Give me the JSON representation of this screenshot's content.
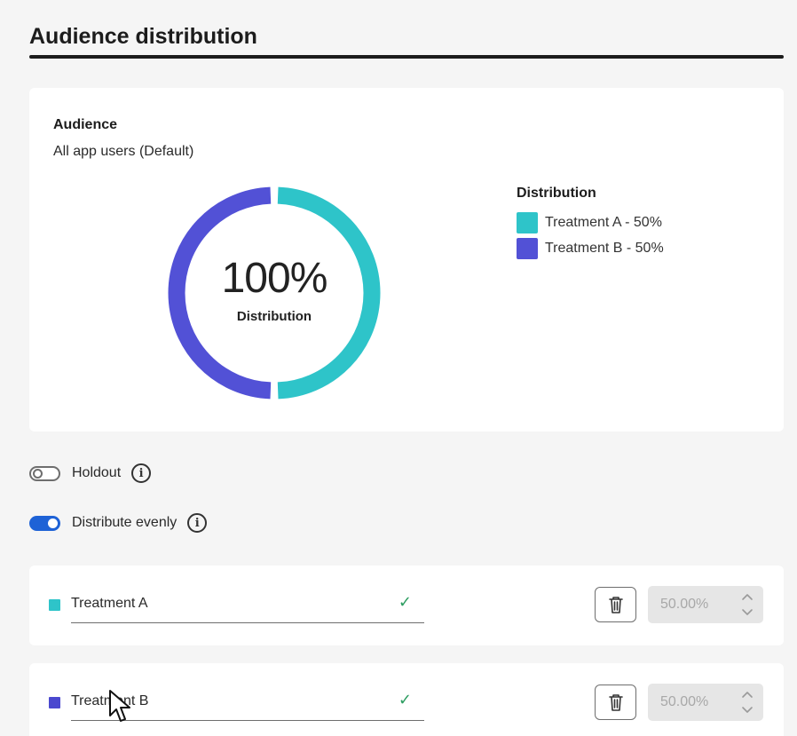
{
  "page": {
    "title": "Audience distribution"
  },
  "audience": {
    "label": "Audience",
    "value": "All app users (Default)"
  },
  "donut": {
    "center_value": "100%",
    "center_label": "Distribution",
    "segments": [
      {
        "name": "Treatment A",
        "fraction": 0.5,
        "color": "#2ec4c9"
      },
      {
        "name": "Treatment B",
        "fraction": 0.5,
        "color": "#5251d6"
      }
    ]
  },
  "legend": {
    "title": "Distribution",
    "items": [
      {
        "label": "Treatment A - 50%",
        "color": "#2ec4c9"
      },
      {
        "label": "Treatment B - 50%",
        "color": "#5251d6"
      }
    ]
  },
  "holdout": {
    "label": "Holdout",
    "enabled": false,
    "icon": "info-icon"
  },
  "distribute_evenly": {
    "label": "Distribute evenly",
    "enabled": true,
    "icon": "info-icon"
  },
  "treatments": [
    {
      "name": "Treatment A",
      "color": "#2ec4c9",
      "percent": "50.00%",
      "valid": true
    },
    {
      "name": "Treatment B",
      "color": "#4a48cf",
      "percent": "50.00%",
      "valid": true
    }
  ],
  "colors": {
    "toggle_on": "#1e62d6",
    "check": "#2d9d61",
    "accent_a": "#2ec4c9",
    "accent_b": "#5251d6"
  }
}
